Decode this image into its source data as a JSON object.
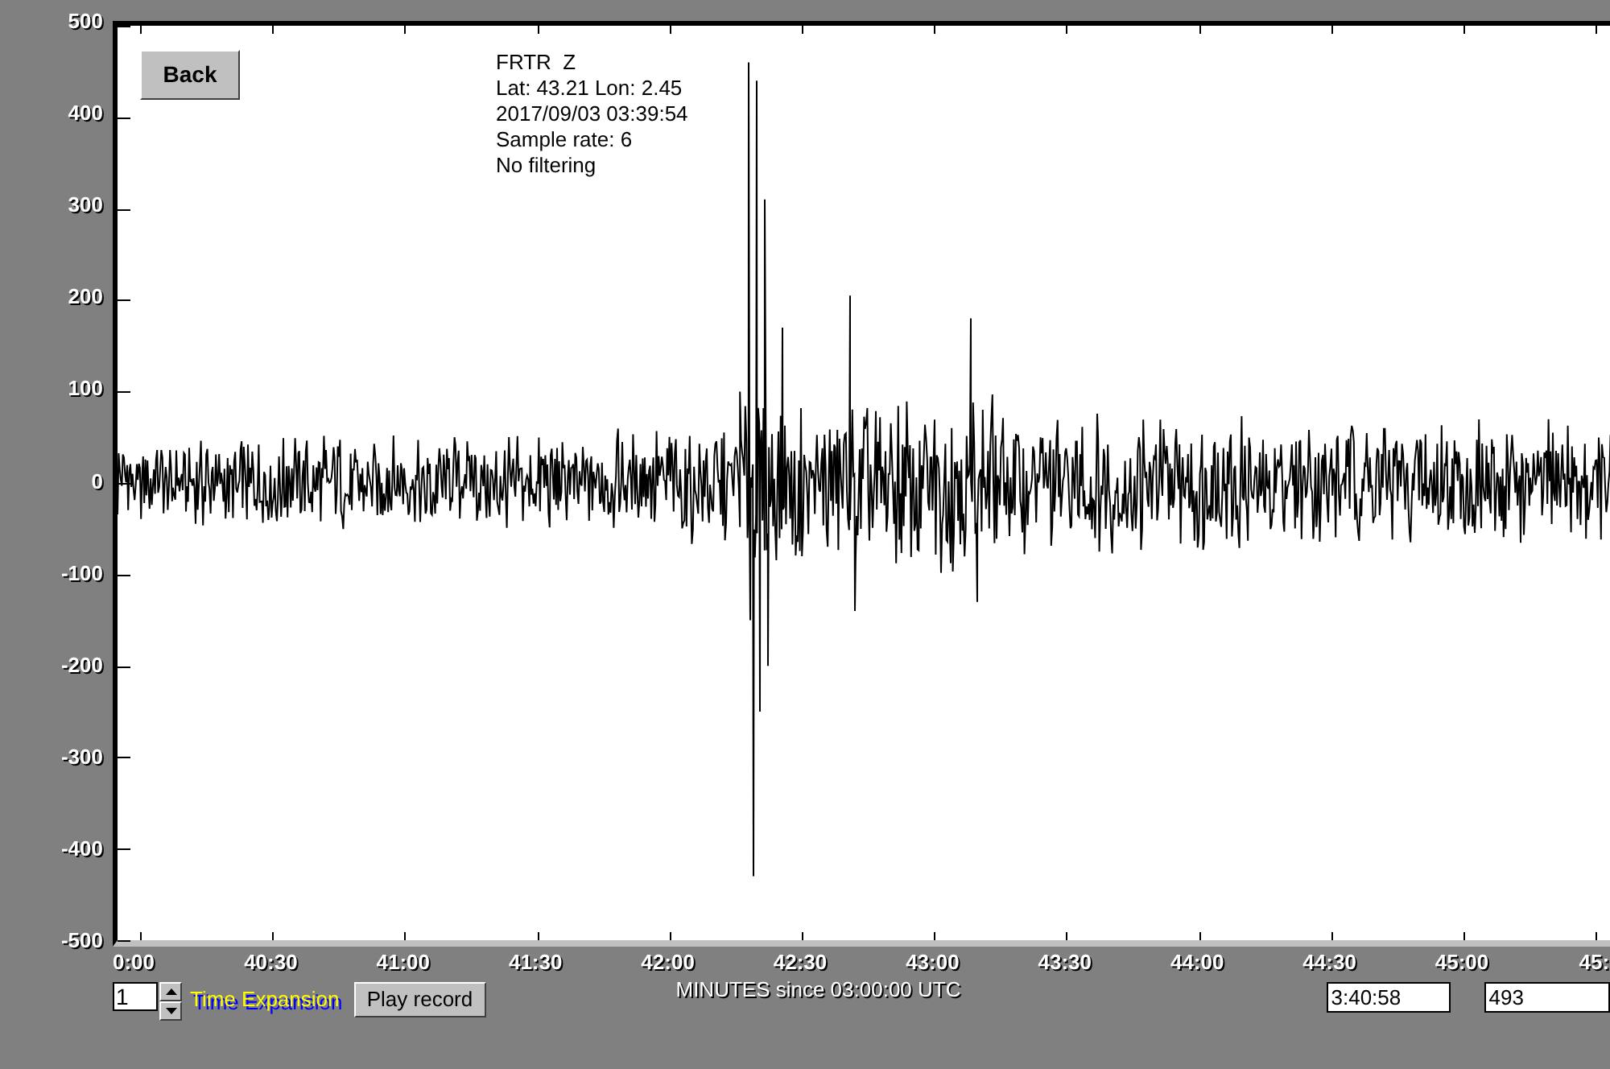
{
  "plot": {
    "y_ticks": [
      "500",
      "400",
      "300",
      "200",
      "100",
      "0",
      "-100",
      "-200",
      "-300",
      "-400",
      "-500"
    ],
    "x_ticks": [
      "0:00",
      "40:30",
      "41:00",
      "41:30",
      "42:00",
      "42:30",
      "43:00",
      "43:30",
      "44:00",
      "44:30",
      "45:00",
      "45:"
    ],
    "back_button": "Back",
    "info": [
      "FRTR  Z",
      "Lat: 43.21 Lon: 2.45",
      "2017/09/03 03:39:54",
      "Sample rate: 6",
      "No filtering"
    ]
  },
  "controls": {
    "time_expansion": {
      "value": "1",
      "label": "Time Expansion"
    },
    "play_button": "Play record",
    "x_caption": "MINUTES since 03:00:00 UTC",
    "time_field": "3:40:58",
    "count_field": "493"
  }
}
